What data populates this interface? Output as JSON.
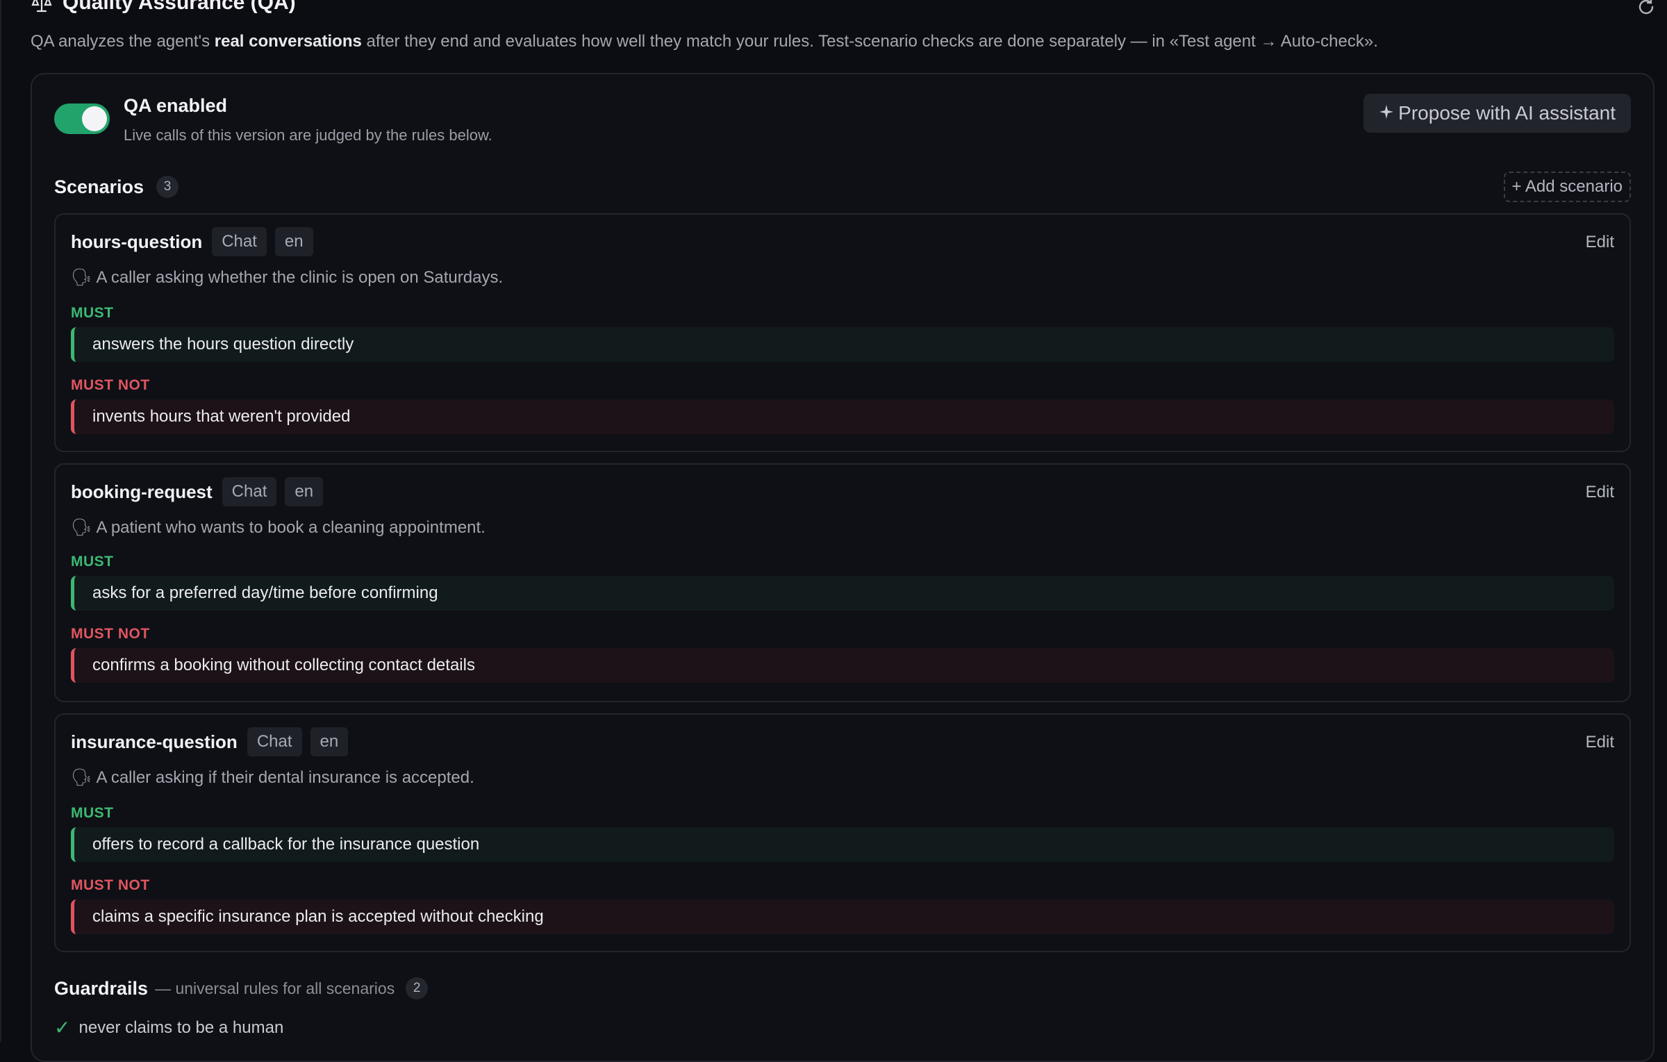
{
  "header": {
    "title": "Quality Assurance (QA)",
    "icon": "scale-icon",
    "refresh_icon": "refresh-icon"
  },
  "description": {
    "part1": "QA analyzes the agent's ",
    "bold": "real conversations",
    "part2": " after they end and evaluates how well they match your rules. Test-scenario checks are done separately — in «Test agent → Auto-check»."
  },
  "toggle": {
    "enabled": true,
    "label": "QA enabled",
    "hint": "Live calls of this version are judged by the rules below."
  },
  "ai_button": {
    "icon": "sparkle-icon",
    "label": "Propose with AI assistant"
  },
  "scenarios": {
    "label": "Scenarios",
    "count": "3",
    "add_label": "+ Add scenario",
    "must_label": "MUST",
    "must_not_label": "MUST NOT",
    "edit_label": "Edit",
    "items": [
      {
        "name": "hours-question",
        "channel": "Chat",
        "lang": "en",
        "persona_icon": "🗣",
        "persona": "A caller asking whether the clinic is open on Saturdays.",
        "must": "answers the hours question directly",
        "must_not": "invents hours that weren't provided"
      },
      {
        "name": "booking-request",
        "channel": "Chat",
        "lang": "en",
        "persona_icon": "🗣",
        "persona": "A patient who wants to book a cleaning appointment.",
        "must": "asks for a preferred day/time before confirming",
        "must_not": "confirms a booking without collecting contact details"
      },
      {
        "name": "insurance-question",
        "channel": "Chat",
        "lang": "en",
        "persona_icon": "🗣",
        "persona": "A caller asking if their dental insurance is accepted.",
        "must": "offers to record a callback for the insurance question",
        "must_not": "claims a specific insurance plan is accepted without checking"
      }
    ]
  },
  "guardrails": {
    "label": "Guardrails",
    "sub": "— universal rules for all scenarios",
    "count": "2",
    "items": [
      {
        "check": "✓",
        "text": "never claims to be a human"
      }
    ]
  },
  "colors": {
    "background": "#0c0d12",
    "toggle_on": "#22a36b",
    "must": "#3eb872",
    "must_not": "#e0555f"
  }
}
